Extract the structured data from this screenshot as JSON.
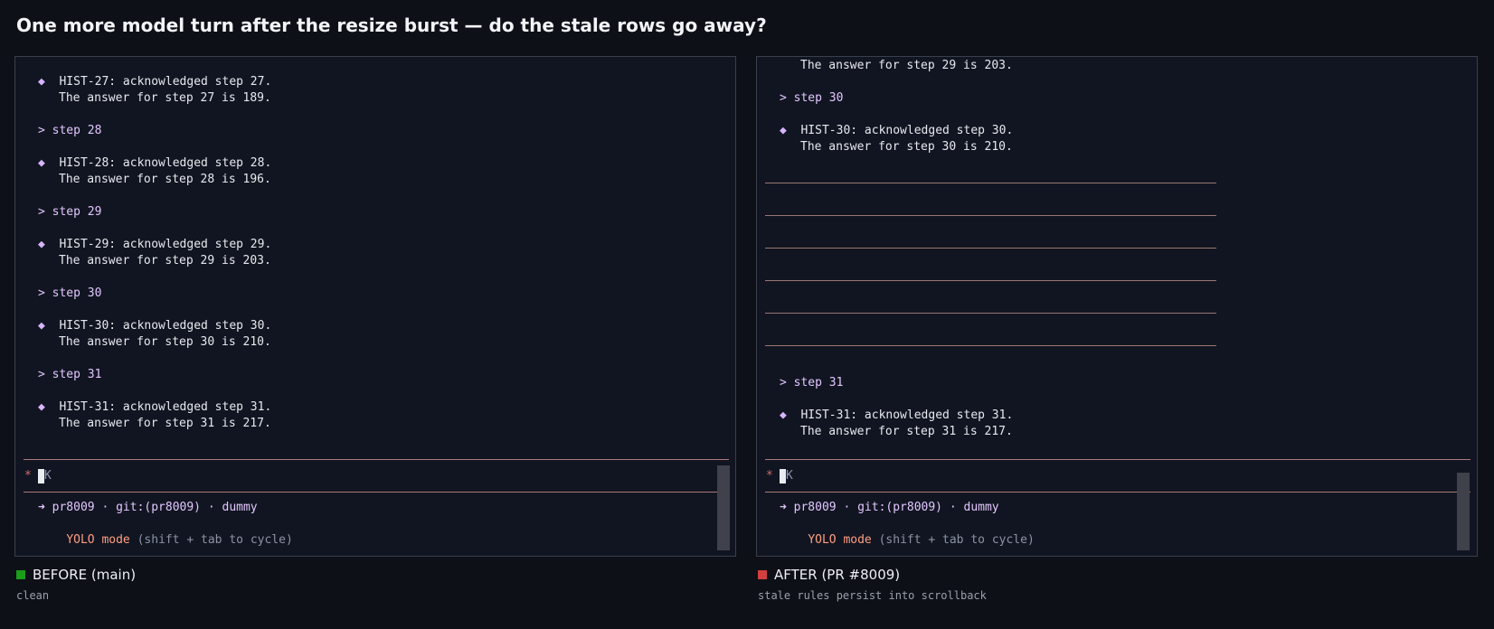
{
  "title": "One more model turn after the resize burst — do the stale rows go away?",
  "panels": {
    "before": {
      "lines": [
        {
          "kind": "hist",
          "marker": "◆",
          "text": "HIST-27: acknowledged step 27."
        },
        {
          "kind": "answer",
          "text": "The answer for step 27 is 189."
        },
        {
          "kind": "prompt",
          "text": "> step 28"
        },
        {
          "kind": "hist",
          "marker": "◆",
          "text": "HIST-28: acknowledged step 28."
        },
        {
          "kind": "answer",
          "text": "The answer for step 28 is 196."
        },
        {
          "kind": "prompt",
          "text": "> step 29"
        },
        {
          "kind": "hist",
          "marker": "◆",
          "text": "HIST-29: acknowledged step 29."
        },
        {
          "kind": "answer",
          "text": "The answer for step 29 is 203."
        },
        {
          "kind": "prompt",
          "text": "> step 30"
        },
        {
          "kind": "hist",
          "marker": "◆",
          "text": "HIST-30: acknowledged step 30."
        },
        {
          "kind": "answer",
          "text": "The answer for step 30 is 210."
        },
        {
          "kind": "prompt",
          "text": "> step 31"
        },
        {
          "kind": "hist",
          "marker": "◆",
          "text": "HIST-31: acknowledged step 31."
        },
        {
          "kind": "answer",
          "text": "The answer for step 31 is 217."
        }
      ],
      "input_star": "*",
      "input_text": "K",
      "status": "➜ pr8009 · git:(pr8009) · dummy",
      "mode_label": "YOLO mode",
      "mode_hint": "(shift + tab to cycle)"
    },
    "after": {
      "lines_top": [
        {
          "kind": "answer",
          "text": "The answer for step 29 is 203."
        },
        {
          "kind": "prompt",
          "text": "> step 30"
        },
        {
          "kind": "hist",
          "marker": "◆",
          "text": "HIST-30: acknowledged step 30."
        },
        {
          "kind": "answer",
          "text": "The answer for step 30 is 210."
        }
      ],
      "stale_rule_count": 6,
      "lines_bottom": [
        {
          "kind": "prompt",
          "text": "> step 31"
        },
        {
          "kind": "hist",
          "marker": "◆",
          "text": "HIST-31: acknowledged step 31."
        },
        {
          "kind": "answer",
          "text": "The answer for step 31 is 217."
        }
      ],
      "input_star": "*",
      "input_text": "K",
      "status": "➜ pr8009 · git:(pr8009) · dummy",
      "mode_label": "YOLO mode",
      "mode_hint": "(shift + tab to cycle)"
    }
  },
  "captions": {
    "before": {
      "label": "BEFORE (main)",
      "sub": "clean",
      "color": "#1a9d1a"
    },
    "after": {
      "label": "AFTER (PR #8009)",
      "sub": "stale rules persist into scrollback",
      "color": "#d23f3f"
    }
  }
}
